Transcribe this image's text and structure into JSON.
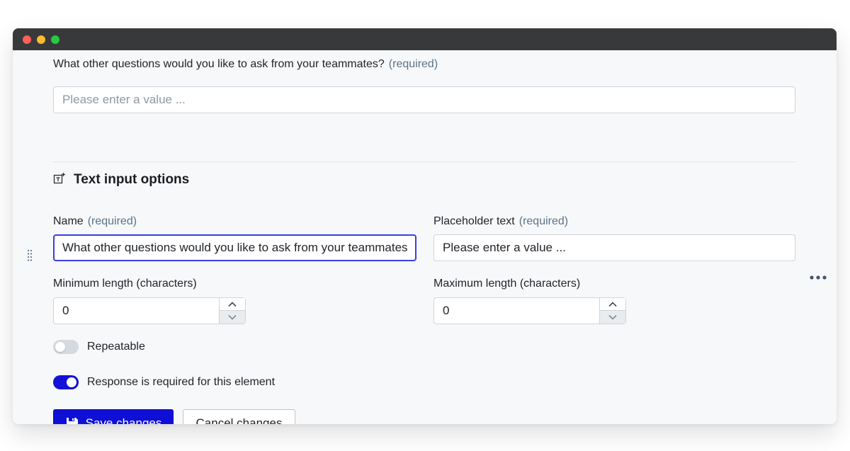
{
  "question": {
    "label": "What other questions would you like to ask from your teammates?",
    "required_tag": "(required)",
    "placeholder": "Please enter a value ..."
  },
  "section": {
    "title": "Text input options",
    "icon": "text-field-add-icon"
  },
  "name_field": {
    "label": "Name",
    "required_tag": "(required)",
    "value": "What other questions would you like to ask from your teammates?"
  },
  "placeholder_field": {
    "label": "Placeholder text",
    "required_tag": "(required)",
    "value": "Please enter a value ..."
  },
  "min_length": {
    "label": "Minimum length (characters)",
    "value": "0"
  },
  "max_length": {
    "label": "Maximum length (characters)",
    "value": "0"
  },
  "toggles": {
    "repeatable": {
      "label": "Repeatable",
      "on": false
    },
    "required": {
      "label": "Response is required for this element",
      "on": true
    }
  },
  "actions": {
    "save_label": "Save changes",
    "cancel_label": "Cancel changes"
  },
  "colors": {
    "accent": "#0f0fd6",
    "focus_border": "#3a3fe0",
    "required_text": "#5d7285"
  }
}
